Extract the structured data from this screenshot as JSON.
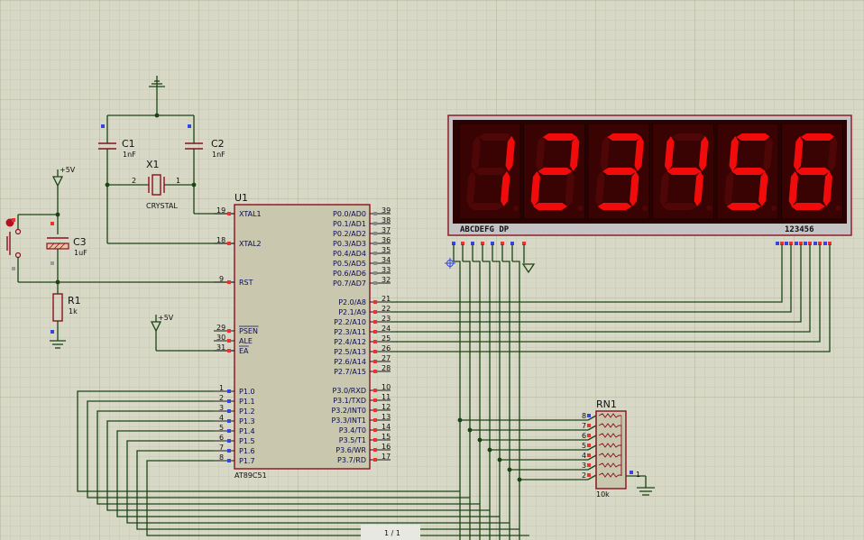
{
  "colors": {
    "background": "#d8d8c6",
    "grid_minor": "#c2c2b0",
    "grid_major": "#b4b4a0",
    "wire": "#1a4414",
    "component": "#8a1020",
    "chip_fill": "#c9c7ad",
    "display_bezel": "#c4c4c4",
    "display_face": "#2b0202",
    "segment_on": "#f20b0b",
    "segment_off": "#4e0606",
    "pin_red": "#ee3030",
    "pin_blue": "#3546e0"
  },
  "mcu": {
    "ref": "U1",
    "part": "AT89C51",
    "left_pins": [
      {
        "num": "19",
        "name": "XTAL1"
      },
      {
        "num": "18",
        "name": "XTAL2"
      },
      {
        "num": "9",
        "name": "RST"
      },
      {
        "num": "29",
        "name": "PSEN"
      },
      {
        "num": "30",
        "name": "ALE"
      },
      {
        "num": "31",
        "name": "EA"
      },
      {
        "num": "1",
        "name": "P1.0"
      },
      {
        "num": "2",
        "name": "P1.1"
      },
      {
        "num": "3",
        "name": "P1.2"
      },
      {
        "num": "4",
        "name": "P1.3"
      },
      {
        "num": "5",
        "name": "P1.4"
      },
      {
        "num": "6",
        "name": "P1.5"
      },
      {
        "num": "7",
        "name": "P1.6"
      },
      {
        "num": "8",
        "name": "P1.7"
      }
    ],
    "right_pins": [
      {
        "num": "39",
        "name": "P0.0/AD0"
      },
      {
        "num": "38",
        "name": "P0.1/AD1"
      },
      {
        "num": "37",
        "name": "P0.2/AD2"
      },
      {
        "num": "36",
        "name": "P0.3/AD3"
      },
      {
        "num": "35",
        "name": "P0.4/AD4"
      },
      {
        "num": "34",
        "name": "P0.5/AD5"
      },
      {
        "num": "33",
        "name": "P0.6/AD6"
      },
      {
        "num": "32",
        "name": "P0.7/AD7"
      },
      {
        "num": "21",
        "name": "P2.0/A8"
      },
      {
        "num": "22",
        "name": "P2.1/A9"
      },
      {
        "num": "23",
        "name": "P2.2/A10"
      },
      {
        "num": "24",
        "name": "P2.3/A11"
      },
      {
        "num": "25",
        "name": "P2.4/A12"
      },
      {
        "num": "26",
        "name": "P2.5/A13"
      },
      {
        "num": "27",
        "name": "P2.6/A14"
      },
      {
        "num": "28",
        "name": "P2.7/A15"
      },
      {
        "num": "10",
        "name": "P3.0/RXD"
      },
      {
        "num": "11",
        "name": "P3.1/TXD"
      },
      {
        "num": "12",
        "name": "P3.2/INT0"
      },
      {
        "num": "13",
        "name": "P3.3/INT1"
      },
      {
        "num": "14",
        "name": "P3.4/T0"
      },
      {
        "num": "15",
        "name": "P3.5/T1"
      },
      {
        "num": "16",
        "name": "P3.6/WR"
      },
      {
        "num": "17",
        "name": "P3.7/RD"
      }
    ]
  },
  "c1": {
    "ref": "C1",
    "value": "1nF"
  },
  "c2": {
    "ref": "C2",
    "value": "1nF"
  },
  "x1": {
    "ref": "X1",
    "value": "CRYSTAL",
    "pin1": "1",
    "pin2": "2"
  },
  "c3": {
    "ref": "C3",
    "value": "1uF"
  },
  "r1": {
    "ref": "R1",
    "value": "1k"
  },
  "power_label": "+5V",
  "power_label_ea": "+5V",
  "rn1": {
    "ref": "RN1",
    "value": "10k",
    "pins": [
      "8",
      "7",
      "6",
      "5",
      "4",
      "3",
      "2"
    ],
    "common_pin": "1"
  },
  "display": {
    "digits": [
      "1",
      "2",
      "3",
      "4",
      "5",
      "6"
    ],
    "segment_label": "ABCDEFG  DP",
    "common_label": "123456"
  },
  "page_indicator": "1 / 1"
}
